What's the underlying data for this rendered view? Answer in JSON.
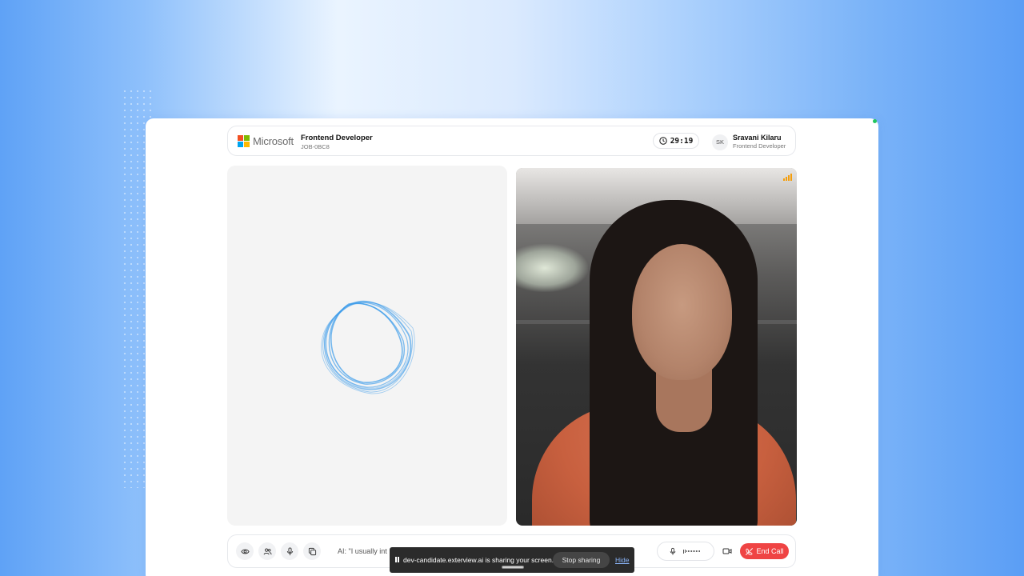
{
  "header": {
    "brand": "Microsoft",
    "job_title": "Frontend Developer",
    "job_id": "JOB-0BC8",
    "timer": "29:19",
    "user_initials": "SK",
    "user_name": "Sravani Kilaru",
    "user_role": "Frontend Developer"
  },
  "ai_panel": {
    "orb_icon": "ai-orb-animation"
  },
  "video": {
    "signal_icon": "signal-strength-icon"
  },
  "controls": {
    "caption": "AI: \"I usually int",
    "end_call_label": "End Call",
    "icons": [
      "eye-icon",
      "people-icon",
      "microphone-icon",
      "copy-icon",
      "microphone-icon",
      "camera-icon",
      "end-call-icon"
    ]
  },
  "share_bar": {
    "message": "dev-candidate.exterview.ai is sharing your screen.",
    "stop_label": "Stop sharing",
    "hide_label": "Hide"
  },
  "colors": {
    "accent_blue": "#3b9bea",
    "end_call_red": "#ef4444",
    "signal_orange": "#f59e0b",
    "ms_red": "#f25022",
    "ms_green": "#7fba00",
    "ms_blue": "#00a4ef",
    "ms_yellow": "#ffb900"
  }
}
